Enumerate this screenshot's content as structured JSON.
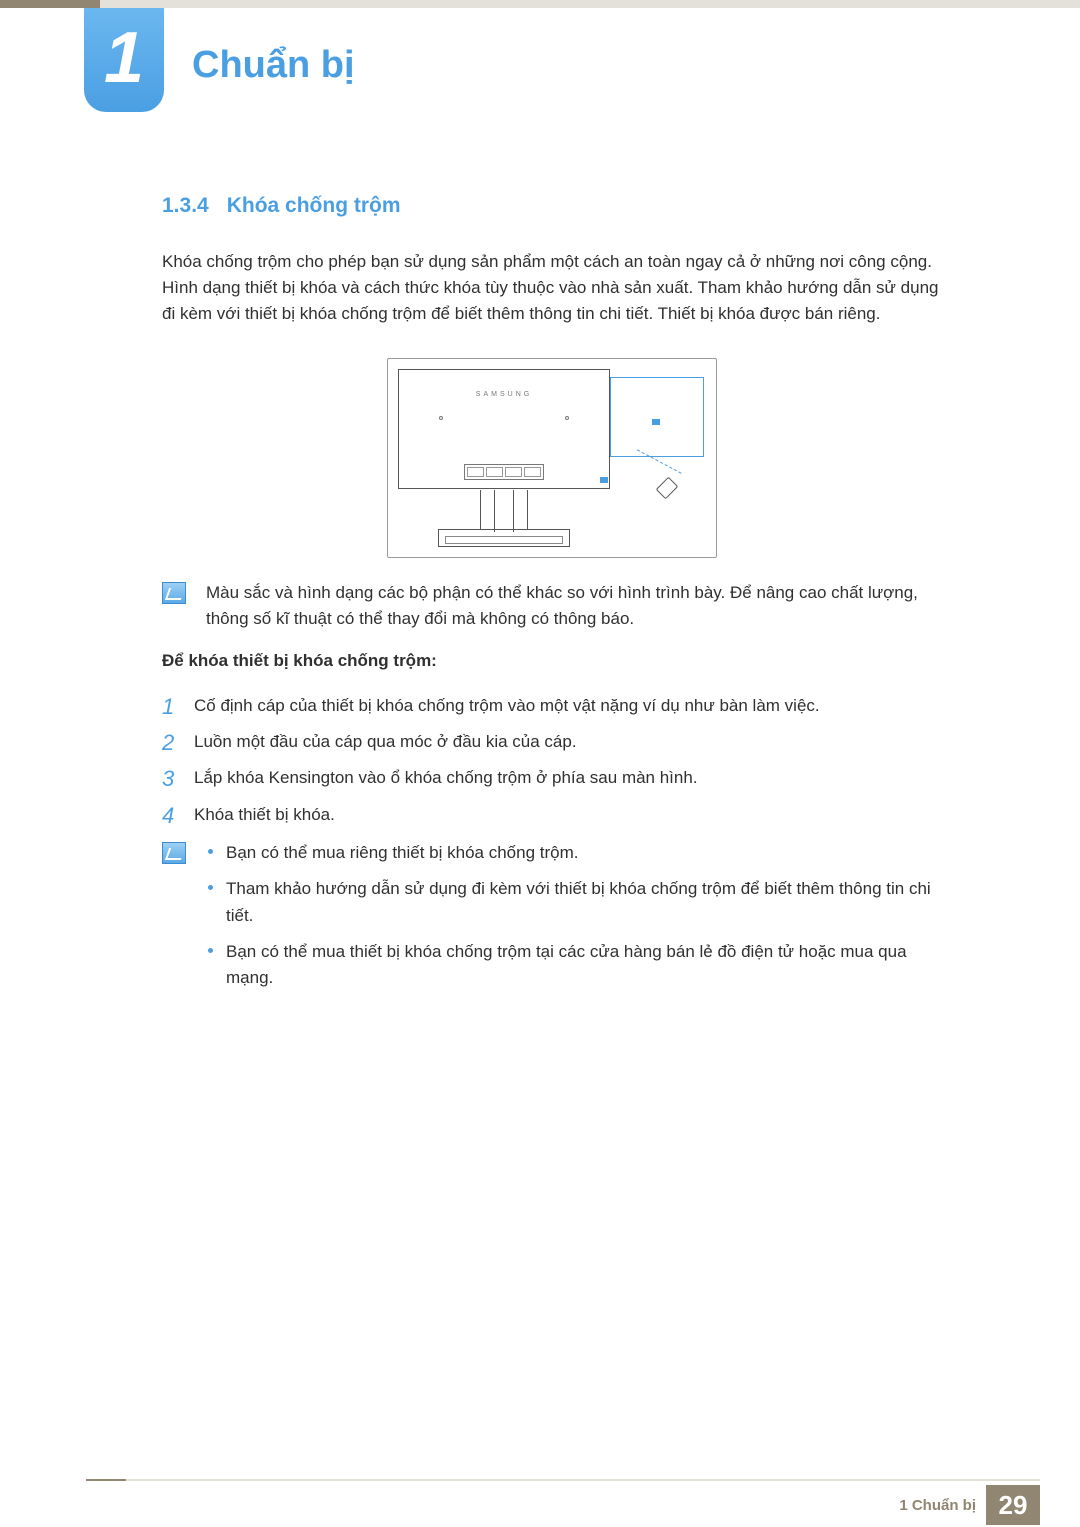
{
  "chapter": {
    "number": "1",
    "title": "Chuẩn bị"
  },
  "section": {
    "number": "1.3.4",
    "title": "Khóa chống trộm"
  },
  "intro": "Khóa chống trộm cho phép bạn sử dụng sản phẩm một cách an toàn ngay cả ở những nơi công cộng. Hình dạng thiết bị khóa và cách thức khóa tùy thuộc vào nhà sản xuất. Tham khảo hướng dẫn sử dụng đi kèm với thiết bị khóa chống trộm để biết thêm thông tin chi tiết. Thiết bị khóa được bán riêng.",
  "figure_brand": "SAMSUNG",
  "note1": "Màu sắc và hình dạng các bộ phận có thể khác so với hình trình bày. Để nâng cao chất lượng, thông số kĩ thuật có thể thay đổi mà không có thông báo.",
  "sub_heading": "Để khóa thiết bị khóa chống trộm:",
  "steps": [
    "Cố định cáp của thiết bị khóa chống trộm vào một vật nặng ví dụ như bàn làm việc.",
    "Luồn một đầu của cáp qua móc ở đầu kia của cáp.",
    "Lắp khóa Kensington vào ổ khóa chống trộm ở phía sau màn hình.",
    "Khóa thiết bị khóa."
  ],
  "step_numbers": [
    "1",
    "2",
    "3",
    "4"
  ],
  "bullets": [
    "Bạn có thể mua riêng thiết bị khóa chống trộm.",
    "Tham khảo hướng dẫn sử dụng đi kèm với thiết bị khóa chống trộm để biết thêm thông tin chi tiết.",
    "Bạn có thể mua thiết bị khóa chống trộm tại các cửa hàng bán lẻ đồ điện tử hoặc mua qua mạng."
  ],
  "footer": {
    "text": "1 Chuẩn bị",
    "page": "29"
  }
}
